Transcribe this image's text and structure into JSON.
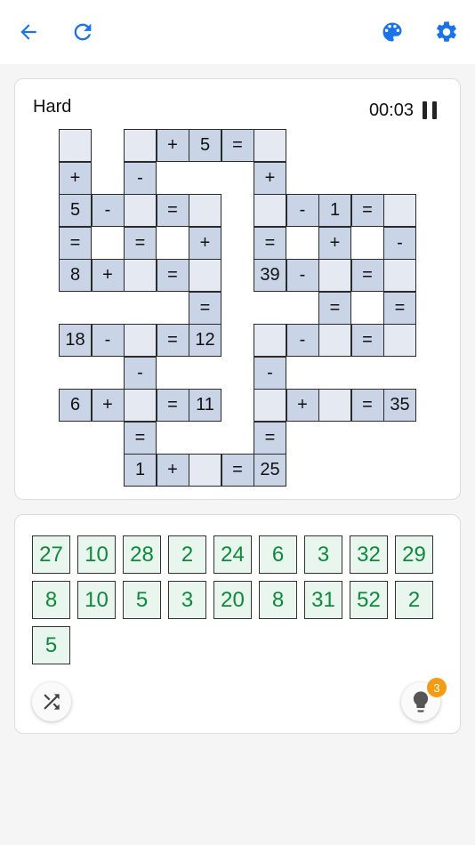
{
  "topbar": {
    "back_icon": "arrow-back-icon",
    "refresh_icon": "refresh-icon",
    "palette_icon": "palette-icon",
    "settings_icon": "gear-icon",
    "accent_color": "#1a73e8"
  },
  "game": {
    "difficulty": "Hard",
    "timer": "00:03",
    "pause_icon": "pause-icon"
  },
  "board": {
    "given_color": "#c9d4e6",
    "blank_color": "#e4e9f2",
    "cells": [
      {
        "r": 0,
        "c": 0,
        "t": "",
        "k": "blank"
      },
      {
        "r": 0,
        "c": 2,
        "t": "",
        "k": "blank"
      },
      {
        "r": 0,
        "c": 3,
        "t": "+",
        "k": "given"
      },
      {
        "r": 0,
        "c": 4,
        "t": "5",
        "k": "given"
      },
      {
        "r": 0,
        "c": 5,
        "t": "=",
        "k": "given"
      },
      {
        "r": 0,
        "c": 6,
        "t": "",
        "k": "blank"
      },
      {
        "r": 1,
        "c": 0,
        "t": "+",
        "k": "given"
      },
      {
        "r": 1,
        "c": 2,
        "t": "-",
        "k": "given"
      },
      {
        "r": 1,
        "c": 6,
        "t": "+",
        "k": "given"
      },
      {
        "r": 2,
        "c": 0,
        "t": "5",
        "k": "given"
      },
      {
        "r": 2,
        "c": 1,
        "t": "-",
        "k": "given"
      },
      {
        "r": 2,
        "c": 2,
        "t": "",
        "k": "blank"
      },
      {
        "r": 2,
        "c": 3,
        "t": "=",
        "k": "given"
      },
      {
        "r": 2,
        "c": 4,
        "t": "",
        "k": "blank"
      },
      {
        "r": 2,
        "c": 6,
        "t": "",
        "k": "blank"
      },
      {
        "r": 2,
        "c": 7,
        "t": "-",
        "k": "given"
      },
      {
        "r": 2,
        "c": 8,
        "t": "1",
        "k": "given"
      },
      {
        "r": 2,
        "c": 9,
        "t": "=",
        "k": "given"
      },
      {
        "r": 2,
        "c": 10,
        "t": "",
        "k": "blank"
      },
      {
        "r": 3,
        "c": 0,
        "t": "=",
        "k": "given"
      },
      {
        "r": 3,
        "c": 2,
        "t": "=",
        "k": "given"
      },
      {
        "r": 3,
        "c": 4,
        "t": "+",
        "k": "given"
      },
      {
        "r": 3,
        "c": 6,
        "t": "=",
        "k": "given"
      },
      {
        "r": 3,
        "c": 8,
        "t": "+",
        "k": "given"
      },
      {
        "r": 3,
        "c": 10,
        "t": "-",
        "k": "given"
      },
      {
        "r": 4,
        "c": 0,
        "t": "8",
        "k": "given"
      },
      {
        "r": 4,
        "c": 1,
        "t": "+",
        "k": "given"
      },
      {
        "r": 4,
        "c": 2,
        "t": "",
        "k": "blank"
      },
      {
        "r": 4,
        "c": 3,
        "t": "=",
        "k": "given"
      },
      {
        "r": 4,
        "c": 4,
        "t": "",
        "k": "blank"
      },
      {
        "r": 4,
        "c": 6,
        "t": "39",
        "k": "given"
      },
      {
        "r": 4,
        "c": 7,
        "t": "-",
        "k": "given"
      },
      {
        "r": 4,
        "c": 8,
        "t": "",
        "k": "blank"
      },
      {
        "r": 4,
        "c": 9,
        "t": "=",
        "k": "given"
      },
      {
        "r": 4,
        "c": 10,
        "t": "",
        "k": "blank"
      },
      {
        "r": 5,
        "c": 4,
        "t": "=",
        "k": "given"
      },
      {
        "r": 5,
        "c": 8,
        "t": "=",
        "k": "given"
      },
      {
        "r": 5,
        "c": 10,
        "t": "=",
        "k": "given"
      },
      {
        "r": 6,
        "c": 0,
        "t": "18",
        "k": "given"
      },
      {
        "r": 6,
        "c": 1,
        "t": "-",
        "k": "given"
      },
      {
        "r": 6,
        "c": 2,
        "t": "",
        "k": "blank"
      },
      {
        "r": 6,
        "c": 3,
        "t": "=",
        "k": "given"
      },
      {
        "r": 6,
        "c": 4,
        "t": "12",
        "k": "given"
      },
      {
        "r": 6,
        "c": 6,
        "t": "",
        "k": "blank"
      },
      {
        "r": 6,
        "c": 7,
        "t": "-",
        "k": "given"
      },
      {
        "r": 6,
        "c": 8,
        "t": "",
        "k": "blank"
      },
      {
        "r": 6,
        "c": 9,
        "t": "=",
        "k": "given"
      },
      {
        "r": 6,
        "c": 10,
        "t": "",
        "k": "blank"
      },
      {
        "r": 7,
        "c": 2,
        "t": "-",
        "k": "given"
      },
      {
        "r": 7,
        "c": 6,
        "t": "-",
        "k": "given"
      },
      {
        "r": 8,
        "c": 0,
        "t": "6",
        "k": "given"
      },
      {
        "r": 8,
        "c": 1,
        "t": "+",
        "k": "given"
      },
      {
        "r": 8,
        "c": 2,
        "t": "",
        "k": "blank"
      },
      {
        "r": 8,
        "c": 3,
        "t": "=",
        "k": "given"
      },
      {
        "r": 8,
        "c": 4,
        "t": "11",
        "k": "given"
      },
      {
        "r": 8,
        "c": 6,
        "t": "",
        "k": "blank"
      },
      {
        "r": 8,
        "c": 7,
        "t": "+",
        "k": "given"
      },
      {
        "r": 8,
        "c": 8,
        "t": "",
        "k": "blank"
      },
      {
        "r": 8,
        "c": 9,
        "t": "=",
        "k": "given"
      },
      {
        "r": 8,
        "c": 10,
        "t": "35",
        "k": "given"
      },
      {
        "r": 9,
        "c": 2,
        "t": "=",
        "k": "given"
      },
      {
        "r": 9,
        "c": 6,
        "t": "=",
        "k": "given"
      },
      {
        "r": 10,
        "c": 2,
        "t": "1",
        "k": "given"
      },
      {
        "r": 10,
        "c": 3,
        "t": "+",
        "k": "given"
      },
      {
        "r": 10,
        "c": 4,
        "t": "",
        "k": "blank"
      },
      {
        "r": 10,
        "c": 5,
        "t": "=",
        "k": "given"
      },
      {
        "r": 10,
        "c": 6,
        "t": "25",
        "k": "given"
      }
    ]
  },
  "tray": {
    "tiles": [
      "27",
      "10",
      "28",
      "2",
      "24",
      "6",
      "3",
      "32",
      "29",
      "8",
      "10",
      "5",
      "3",
      "20",
      "8",
      "31",
      "52",
      "2",
      "5"
    ],
    "tile_color": "#0d8a3c",
    "shuffle_icon": "shuffle-icon",
    "hint_icon": "lightbulb-icon",
    "hint_count": "3"
  }
}
